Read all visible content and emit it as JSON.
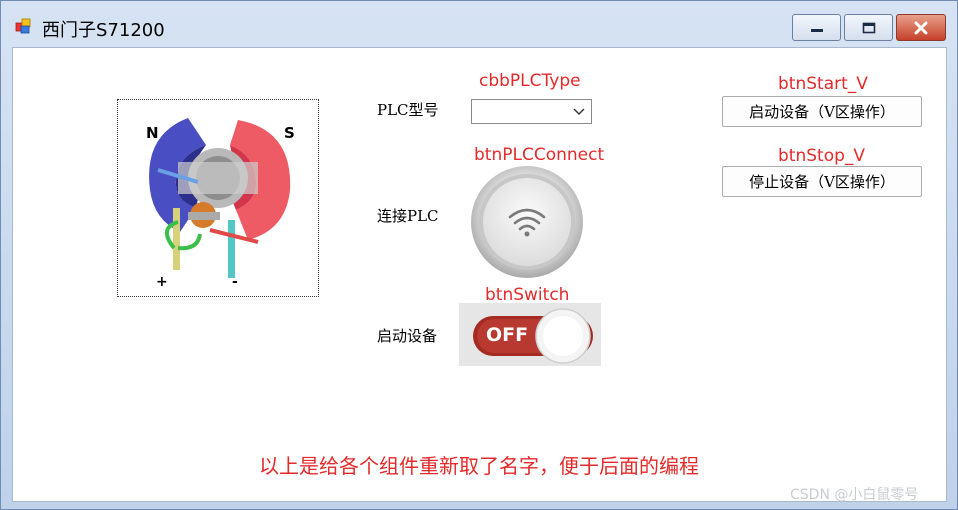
{
  "window": {
    "title": "西门子S71200",
    "controls": {
      "minimize": "minimize-icon",
      "maximize": "maximize-icon",
      "close": "close-icon"
    }
  },
  "motor_image": {
    "pole_north": "N",
    "pole_south": "S",
    "plus": "+",
    "minus": "-"
  },
  "labels": {
    "plc_type": "PLC型号",
    "connect": "连接PLC",
    "start_device": "启动设备"
  },
  "annotations": {
    "cbb": "cbbPLCType",
    "connect_btn": "btnPLCConnect",
    "switch": "btnSwitch",
    "start_v": "btnStart_V",
    "stop_v": "btnStop_V"
  },
  "combo": {
    "value": ""
  },
  "buttons": {
    "start_v": "启动设备（V区操作）",
    "stop_v": "停止设备（V区操作）"
  },
  "switch": {
    "state": "OFF"
  },
  "footer": "以上是给各个组件重新取了名字，便于后面的编程",
  "watermark": "CSDN @小白鼠零号",
  "colors": {
    "annotation": "#e42a2a",
    "switch_off": "#a42a22"
  }
}
